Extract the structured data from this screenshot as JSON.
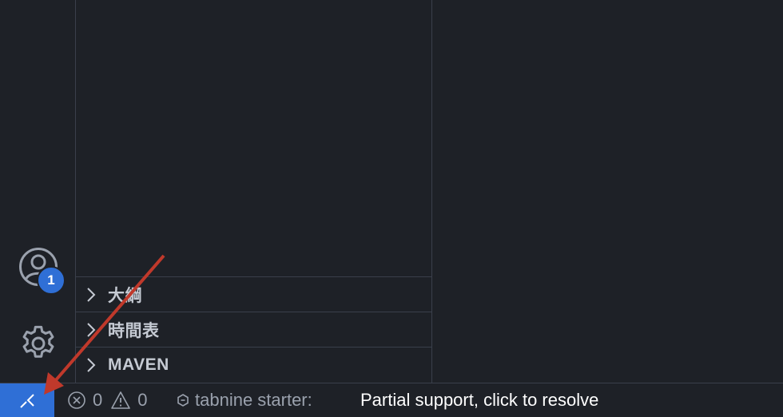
{
  "activity_bar": {
    "account_badge_count": "1",
    "icons": [
      "account-icon",
      "gear-icon"
    ]
  },
  "sidebar": {
    "sections": [
      {
        "title": "大綱",
        "icon": "chevron-right-icon"
      },
      {
        "title": "時間表",
        "icon": "chevron-right-icon"
      },
      {
        "title": "MAVEN",
        "icon": "chevron-right-icon"
      }
    ]
  },
  "status_bar": {
    "remote_icon": "remote-icon",
    "errors_count": "0",
    "warnings_count": "0",
    "tabnine_label": "tabnine starter:",
    "tabnine_message": "Partial support, click to resolve"
  },
  "colors": {
    "background": "#1e2127",
    "border": "#3a3f4b",
    "accent": "#2f6fd6",
    "annotation_arrow": "#c0392b"
  }
}
